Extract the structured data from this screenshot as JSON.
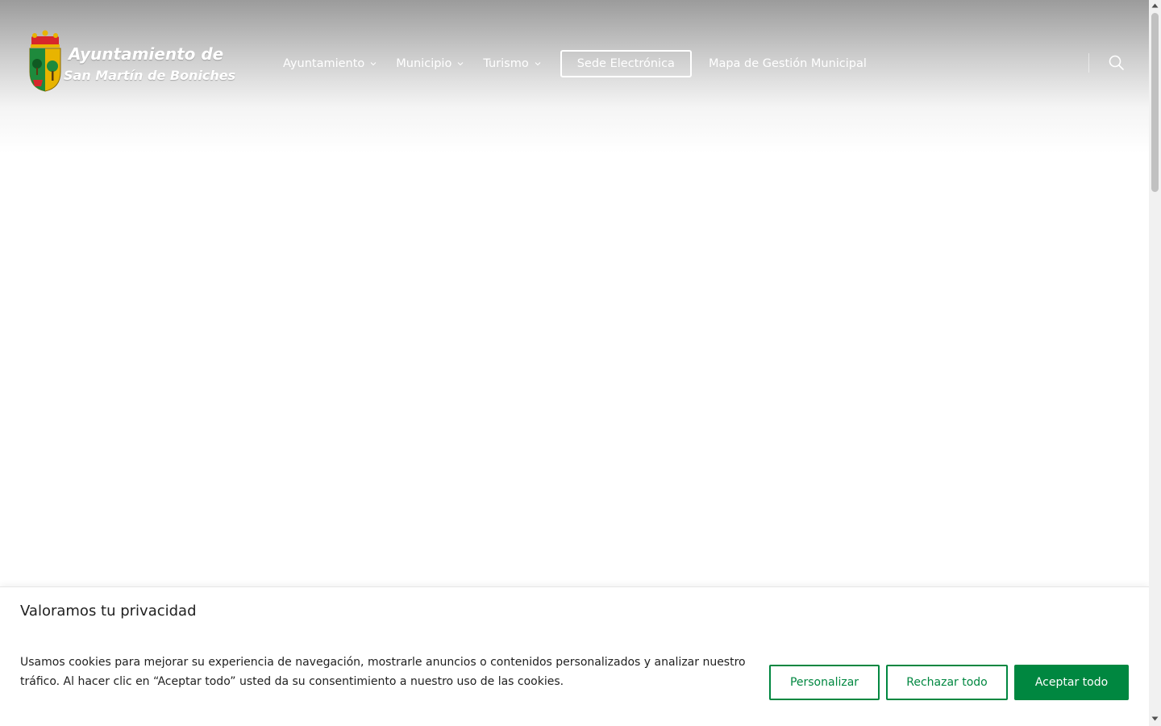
{
  "logo": {
    "line1": "Ayuntamiento de",
    "line2": "San Martín de Boniches",
    "shield_icon": "coat-of-arms-icon"
  },
  "nav": {
    "items": [
      {
        "label": "Ayuntamiento",
        "has_dropdown": true
      },
      {
        "label": "Municipio",
        "has_dropdown": true
      },
      {
        "label": "Turismo",
        "has_dropdown": true
      }
    ],
    "sede_label": "Sede Electrónica",
    "mapa_label": "Mapa de Gestión Municipal",
    "search_icon": "search-icon"
  },
  "cookie_banner": {
    "title": "Valoramos tu privacidad",
    "text": "Usamos cookies para mejorar su experiencia de navegación, mostrarle anuncios o contenidos personalizados y analizar nuestro tráfico. Al hacer clic en “Aceptar todo” usted da su consentimiento a nuestro uso de las cookies.",
    "buttons": {
      "customize": "Personalizar",
      "reject": "Rechazar todo",
      "accept": "Aceptar todo"
    },
    "accent_color": "#008740"
  }
}
